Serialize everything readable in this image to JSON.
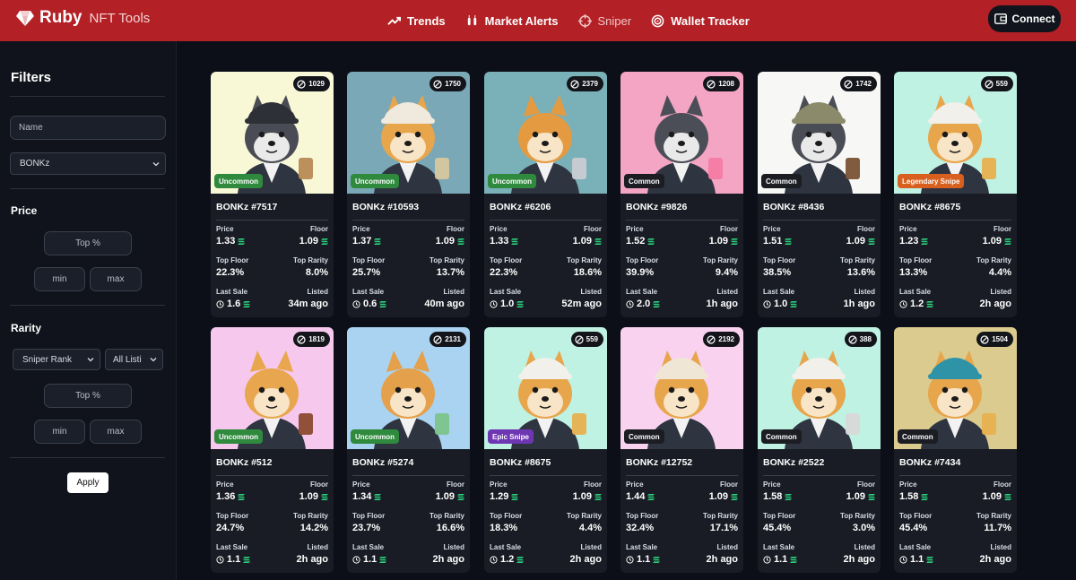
{
  "brand": {
    "name": "Ruby",
    "sub": "NFT Tools"
  },
  "nav": [
    {
      "label": "Trends",
      "icon": "trend-icon"
    },
    {
      "label": "Market Alerts",
      "icon": "alert-icon"
    },
    {
      "label": "Sniper",
      "icon": "crosshair-icon"
    },
    {
      "label": "Wallet Tracker",
      "icon": "radar-icon"
    }
  ],
  "connect_label": "Connect",
  "sidebar": {
    "filters_title": "Filters",
    "name_placeholder": "Name",
    "collection": "BONKz",
    "price_title": "Price",
    "top_pct_placeholder": "Top %",
    "min_placeholder": "min",
    "max_placeholder": "max",
    "rarity_title": "Rarity",
    "rank_select": "Sniper Rank",
    "listing_select": "All Listi",
    "apply_label": "Apply"
  },
  "labels": {
    "price": "Price",
    "floor": "Floor",
    "top_floor": "Top Floor",
    "top_rarity": "Top Rarity",
    "last_sale": "Last Sale",
    "listed": "Listed"
  },
  "cards": [
    {
      "title": "BONKz #7517",
      "count": "1029",
      "rarity": "Uncommon",
      "price": "1.33",
      "floor": "1.09",
      "top_floor": "22.3%",
      "top_rarity": "8.0%",
      "last_sale": "1.6",
      "listed": "34m ago",
      "bg": "#f8f8d6",
      "fur": "#4a4c55",
      "face": "#eaeaea",
      "hat": "#2e3037",
      "item": "#b78a55"
    },
    {
      "title": "BONKz #10593",
      "count": "1750",
      "rarity": "Uncommon",
      "price": "1.37",
      "floor": "1.09",
      "top_floor": "25.7%",
      "top_rarity": "13.7%",
      "last_sale": "0.6",
      "listed": "40m ago",
      "bg": "#7aa8b6",
      "fur": "#e7a54c",
      "face": "#f8e4c6",
      "hat": "#efe9de",
      "item": "#d6c79e"
    },
    {
      "title": "BONKz #6206",
      "count": "2379",
      "rarity": "Uncommon",
      "price": "1.33",
      "floor": "1.09",
      "top_floor": "22.3%",
      "top_rarity": "18.6%",
      "last_sale": "1.0",
      "listed": "52m ago",
      "bg": "#7ab0b8",
      "fur": "#e49a41",
      "face": "#f8e4c6",
      "hat": "",
      "item": "#c9ccd1"
    },
    {
      "title": "BONKz #9826",
      "count": "1208",
      "rarity": "Common",
      "price": "1.52",
      "floor": "1.09",
      "top_floor": "39.9%",
      "top_rarity": "9.4%",
      "last_sale": "2.0",
      "listed": "1h ago",
      "bg": "#f4a5c3",
      "fur": "#4c4e57",
      "face": "#e9e9e9",
      "hat": "",
      "item": "#f37ba3"
    },
    {
      "title": "BONKz #8436",
      "count": "1742",
      "rarity": "Common",
      "price": "1.51",
      "floor": "1.09",
      "top_floor": "38.5%",
      "top_rarity": "13.6%",
      "last_sale": "1.0",
      "listed": "1h ago",
      "bg": "#f7f7f5",
      "fur": "#4b4d56",
      "face": "#e9e9e9",
      "hat": "#8b8a6a",
      "item": "#7a5233"
    },
    {
      "title": "BONKz #8675",
      "count": "559",
      "rarity": "Legendary Snipe",
      "price": "1.23",
      "floor": "1.09",
      "top_floor": "13.3%",
      "top_rarity": "4.4%",
      "last_sale": "1.2",
      "listed": "2h ago",
      "bg": "#bff2e3",
      "fur": "#e7a54c",
      "face": "#f8e4c6",
      "hat": "#f2f0ea",
      "item": "#e7b04e"
    },
    {
      "title": "BONKz #512",
      "count": "1819",
      "rarity": "Uncommon",
      "price": "1.36",
      "floor": "1.09",
      "top_floor": "24.7%",
      "top_rarity": "14.2%",
      "last_sale": "1.1",
      "listed": "2h ago",
      "bg": "#f6c8ee",
      "fur": "#e8a64e",
      "face": "#f8e4c6",
      "hat": "",
      "item": "#8b4a2f"
    },
    {
      "title": "BONKz #5274",
      "count": "2131",
      "rarity": "Uncommon",
      "price": "1.34",
      "floor": "1.09",
      "top_floor": "23.7%",
      "top_rarity": "16.6%",
      "last_sale": "1.1",
      "listed": "2h ago",
      "bg": "#a9d3f0",
      "fur": "#e4a04a",
      "face": "#f8e4c6",
      "hat": "",
      "item": "#7cc48b"
    },
    {
      "title": "BONKz #8675",
      "count": "559",
      "rarity": "Epic Snipe",
      "price": "1.29",
      "floor": "1.09",
      "top_floor": "18.3%",
      "top_rarity": "4.4%",
      "last_sale": "1.2",
      "listed": "2h ago",
      "bg": "#bff2e3",
      "fur": "#e7a54c",
      "face": "#f8e4c6",
      "hat": "#f2f0ea",
      "item": "#e7b04e"
    },
    {
      "title": "BONKz #12752",
      "count": "2192",
      "rarity": "Common",
      "price": "1.44",
      "floor": "1.09",
      "top_floor": "32.4%",
      "top_rarity": "17.1%",
      "last_sale": "1.1",
      "listed": "2h ago",
      "bg": "#f9d2ef",
      "fur": "#e7a54c",
      "face": "#f8e4c6",
      "hat": "#efe6d6",
      "item": ""
    },
    {
      "title": "BONKz #2522",
      "count": "388",
      "rarity": "Common",
      "price": "1.58",
      "floor": "1.09",
      "top_floor": "45.4%",
      "top_rarity": "3.0%",
      "last_sale": "1.1",
      "listed": "2h ago",
      "bg": "#bff2e3",
      "fur": "#e7a54c",
      "face": "#f8e4c6",
      "hat": "#f2f0ea",
      "item": "#d8d8d8"
    },
    {
      "title": "BONKz #7434",
      "count": "1504",
      "rarity": "Common",
      "price": "1.58",
      "floor": "1.09",
      "top_floor": "45.4%",
      "top_rarity": "11.7%",
      "last_sale": "1.1",
      "listed": "2h ago",
      "bg": "#dccb8f",
      "fur": "#e7a54c",
      "face": "#f8e4c6",
      "hat": "#2e93a6",
      "item": "#e7b04e"
    }
  ],
  "rarity_colors": {
    "Uncommon": "#2f8a3e",
    "Common": "#1b1d23",
    "Legendary Snipe": "#d85f1d",
    "Epic Snipe": "#6e36b3"
  }
}
